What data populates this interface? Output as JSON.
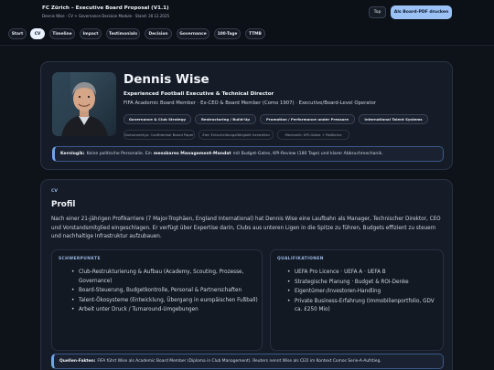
{
  "header": {
    "title": "FC Zürich – Executive Board Proposal (V1.1)",
    "subtitle": "Dennis Wise · CV + Governance Decision Module · Stand: 30.12.2025",
    "top_button": "Top",
    "pdf_button": "Als Board-PDF drucken"
  },
  "nav": {
    "tabs": [
      "Start",
      "CV",
      "Timeline",
      "Impact",
      "Testimonials",
      "Decision",
      "Governance",
      "100-Tage",
      "TTMB"
    ],
    "active": "CV"
  },
  "hero": {
    "name": "Dennis Wise",
    "role": "Experienced Football Executive & Technical Director",
    "line": "FIFA Academic Board Member · Ex-CEO & Board Member (Como 1907) · Executive/Board-Level Operator",
    "badges": [
      "Governance & Club Strategy",
      "Restructuring / Build-Up",
      "Promotion / Performance under Pressure",
      "International Talent Systems"
    ],
    "chips": [
      "Dokumenttyp: Confidential Board Paper",
      "Ziel: Entscheidungsfähigkeit herstellen",
      "Mechanik: KPI-Gates + Reißleine"
    ],
    "callout_label": "Kernlogik:",
    "callout_pre": "Keine politische Personalie. Ein",
    "callout_strong": "messbares Management-Mandat",
    "callout_post": "mit Budget-Gates, KPI-Review (180 Tage) und klarer Abbruchmechanik."
  },
  "cv": {
    "kicker": "CV",
    "title": "Profil",
    "paragraph": "Nach einer 21-jährigen Profikarriere (7 Major-Trophäen, England International) hat Dennis Wise eine Laufbahn als Manager, Technischer Direktor, CEO und Vorstandsmitglied eingeschlagen. Er verfügt über Expertise darin, Clubs aus unteren Ligen in die Spitze zu führen, Budgets effizient zu steuern und nachhaltige Infrastruktur aufzubauen.",
    "strengths_title": "SCHWERPUNKTE",
    "strengths": [
      "Club-Restrukturierung & Aufbau (Academy, Scouting, Prozesse, Governance)",
      "Board-Steuerung, Budgetkontrolle, Personal & Partnerschaften",
      "Talent-Ökosysteme (Entwicklung, Übergang in europäischen Fußball)",
      "Arbeit unter Druck / Turnaround-Umgebungen"
    ],
    "qualifications_title": "QUALIFIKATIONEN",
    "qualifications": [
      "UEFA Pro Licence · UEFA A · UEFA B",
      "Strategische Planung · Budget & ROI-Denke",
      "Eigentümer-/Investoren-Handling",
      "Private Business-Erfahrung (Immobilienportfolio, GDV ca. £250 Mio)"
    ],
    "sources_label": "Quellen-Fakten:",
    "sources_text": "FIFA führt Wise als Academic Board Member (Diploma in Club Management). Reuters nennt Wise als CEO im Kontext Comos Serie-A-Aufstieg."
  }
}
